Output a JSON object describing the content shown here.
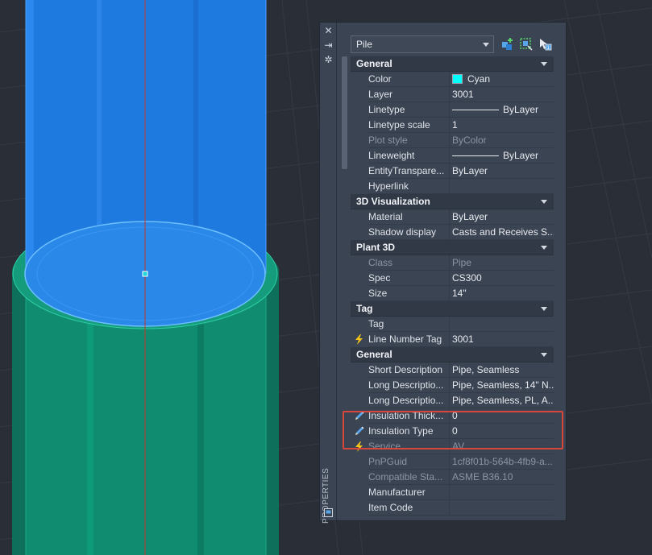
{
  "palette": {
    "side_label": "PROPERTIES",
    "object_type": "Pile",
    "toolbar": {
      "quick_select_icon": "quick-select-icon",
      "select_objects_icon": "select-objects-icon",
      "toggle_pickadd_icon": "toggle-pickadd-icon"
    },
    "sections": [
      {
        "title": "General",
        "rows": [
          {
            "name": "Color",
            "value": "Cyan",
            "swatch": "#00ffff"
          },
          {
            "name": "Layer",
            "value": "3001"
          },
          {
            "name": "Linetype",
            "value": "ByLayer",
            "line": true
          },
          {
            "name": "Linetype scale",
            "value": "1"
          },
          {
            "name": "Plot style",
            "value": "ByColor",
            "dim": true
          },
          {
            "name": "Lineweight",
            "value": "ByLayer",
            "line": true
          },
          {
            "name": "EntityTranspare...",
            "value": "ByLayer"
          },
          {
            "name": "Hyperlink",
            "value": ""
          }
        ]
      },
      {
        "title": "3D Visualization",
        "rows": [
          {
            "name": "Material",
            "value": "ByLayer"
          },
          {
            "name": "Shadow display",
            "value": "Casts and Receives S..."
          }
        ]
      },
      {
        "title": "Plant 3D",
        "rows": [
          {
            "name": "Class",
            "value": "Pipe",
            "dim": true
          },
          {
            "name": "Spec",
            "value": "CS300"
          },
          {
            "name": "Size",
            "value": "14\""
          }
        ]
      },
      {
        "title": "Tag",
        "rows": [
          {
            "name": "Tag",
            "value": ""
          },
          {
            "name": "Line Number Tag",
            "value": "3001",
            "icon": "lightning-icon"
          }
        ]
      },
      {
        "title": "General",
        "rows": [
          {
            "name": "Short Description",
            "value": "Pipe, Seamless"
          },
          {
            "name": "Long Descriptio...",
            "value": "Pipe, Seamless, 14\" N..."
          },
          {
            "name": "Long Descriptio...",
            "value": "Pipe, Seamless, PL, A..."
          },
          {
            "name": "Insulation Thick...",
            "value": "0",
            "icon": "pencil-icon"
          },
          {
            "name": "Insulation Type",
            "value": "0",
            "icon": "pencil-icon"
          },
          {
            "name": "Service",
            "value": "AV",
            "icon": "lightning-icon",
            "dim": true
          },
          {
            "name": "PnPGuid",
            "value": "1cf8f01b-564b-4fb9-a...",
            "dim": true
          },
          {
            "name": "Compatible Sta...",
            "value": "ASME B36.10",
            "dim": true
          },
          {
            "name": "Manufacturer",
            "value": ""
          },
          {
            "name": "Item Code",
            "value": ""
          }
        ]
      }
    ]
  },
  "colors": {
    "upper_pipe": "#1f7ae0",
    "lower_pipe": "#0f8a6f",
    "highlight": "#d9463c",
    "centerline": "#c0392b"
  }
}
